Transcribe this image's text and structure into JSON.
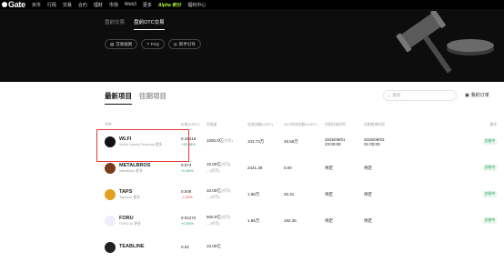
{
  "topbar": {
    "logo": "Gate",
    "items": [
      "买币",
      "行情",
      "交易",
      "合约",
      "理财",
      "市场",
      "Web3",
      "更多"
    ],
    "alpha": "Alpha 积分",
    "mining": "福利中心"
  },
  "hero": {
    "tabs": [
      "盘前交易",
      "盘前OTC交易"
    ],
    "buttons": [
      "交易规则",
      "FAQ",
      "新手引导"
    ]
  },
  "subtabs": [
    "最新项目",
    "往期项目"
  ],
  "search": {
    "placeholder": "搜索"
  },
  "myorders": "我的订单",
  "table": {
    "headers": [
      "币种",
      "价格(USDT)",
      "交易量",
      "总成交额(USDT)",
      "24小时成交额(USDT)",
      "交割开始时间",
      "交割结束时间",
      "操作"
    ],
    "rows": [
      {
        "symbol": "WLFI",
        "name": "World Liberty Financial",
        "more": "更多",
        "price": "0.41416",
        "change": "+33.68%",
        "volume": "1000.0亿",
        "volume_unit": "(代币)",
        "volume2": "",
        "total": "103.73万",
        "vol24": "49.58万",
        "start": "2025/09/01",
        "start_time": "23:00:00",
        "end": "2025/09/02",
        "end_time": "01:00:00",
        "status": "交易中",
        "icon_color": "#111111"
      },
      {
        "symbol": "METALBROS",
        "name": "MetalBros",
        "more": "更多",
        "price": "0.074",
        "change": "+0.00%",
        "volume": "10.00亿",
        "volume_unit": "(代币)",
        "volume2": "-- (代币)",
        "total": "2441.39",
        "vol24": "0.00",
        "start": "待定",
        "start_time": "",
        "end": "待定",
        "end_time": "",
        "status": "交易中",
        "icon_color": "#7a3b1a"
      },
      {
        "symbol": "TAPS",
        "name": "Tapzone",
        "more": "更多",
        "price": "0.049",
        "change": "-7.23%",
        "volume": "10.00亿",
        "volume_unit": "(代币)",
        "volume2": "-- (代币)",
        "total": "1.98万",
        "vol24": "25.31",
        "start": "待定",
        "start_time": "",
        "end": "待定",
        "end_time": "",
        "status": "交易中",
        "icon_color": "#e0a020"
      },
      {
        "symbol": "FORU",
        "name": "FORU AI",
        "more": "更多",
        "price": "0.01272",
        "change": "+0.00%",
        "volume": "500.0亿",
        "volume_unit": "(代币)",
        "volume2": "-- (代币)",
        "total": "1.65万",
        "vol24": "192.36",
        "start": "待定",
        "start_time": "",
        "end": "待定",
        "end_time": "",
        "status": "交易中",
        "icon_color": "#f1eefc"
      },
      {
        "symbol": "TEABLINE",
        "name": "",
        "more": "",
        "price": "0.02",
        "change": "",
        "volume": "10.00亿",
        "volume_unit": "",
        "volume2": "",
        "total": "",
        "vol24": "",
        "start": "",
        "start_time": "",
        "end": "",
        "end_time": "",
        "status": "",
        "icon_color": "#222222"
      }
    ]
  }
}
